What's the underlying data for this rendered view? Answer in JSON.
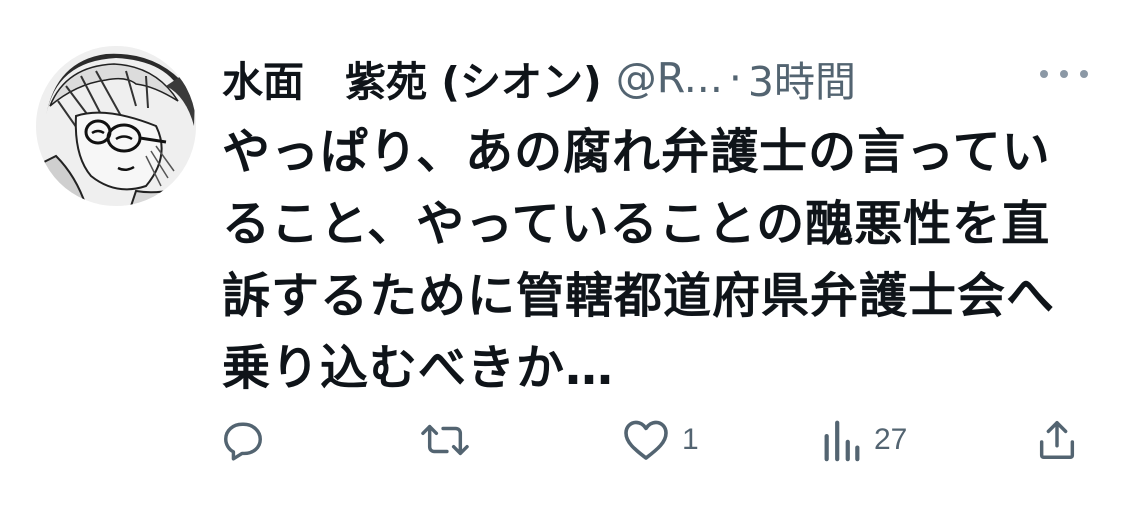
{
  "tweet": {
    "display_name": "水面　紫苑 (シオン)",
    "handle": "@R...",
    "separator": "·",
    "time": "3時間",
    "text": "やっぱり、あの腐れ弁護士の言っていること、やっていることの醜悪性を直訴するために管轄都道府県弁護士会へ乗り込むべきか…"
  },
  "actions": {
    "reply_count": "",
    "retweet_count": "",
    "like_count": "1",
    "views_count": "27"
  },
  "icons": {
    "more": "more-dots-icon",
    "reply": "reply-bubble-icon",
    "retweet": "retweet-icon",
    "like": "heart-icon",
    "views": "views-bar-chart-icon",
    "share": "share-upload-icon"
  },
  "colors": {
    "text_primary": "#0f1419",
    "text_secondary": "#536471",
    "background": "#ffffff"
  }
}
